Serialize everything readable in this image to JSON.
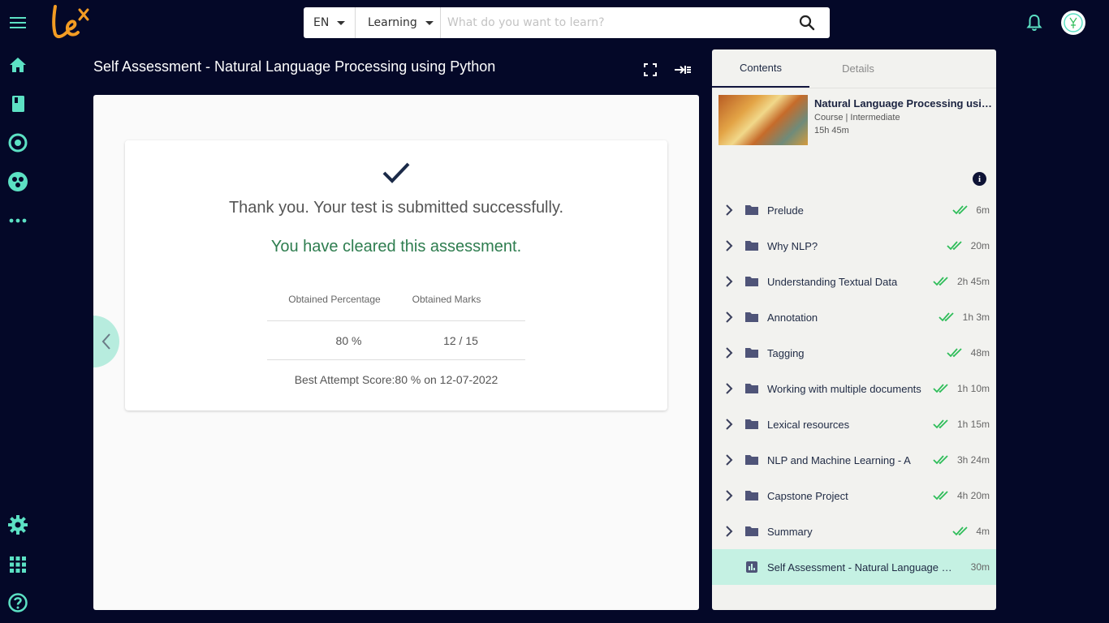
{
  "left_nav": {
    "items": [
      {
        "name": "menu-icon"
      },
      {
        "name": "home-icon"
      },
      {
        "name": "book-icon"
      },
      {
        "name": "target-icon"
      },
      {
        "name": "community-icon"
      },
      {
        "name": "more-icon"
      },
      {
        "name": "settings-icon"
      },
      {
        "name": "apps-icon"
      },
      {
        "name": "help-icon"
      }
    ]
  },
  "search": {
    "language": "EN",
    "category": "Learning",
    "placeholder": "What do you want to learn?"
  },
  "page_title": "Self Assessment - Natural Language Processing using Python",
  "result": {
    "thanks": "Thank you. Your test is submitted successfully.",
    "cleared": "You have cleared this assessment.",
    "col_percentage": "Obtained Percentage",
    "col_marks": "Obtained Marks",
    "percentage": "80 %",
    "marks": "12 / 15",
    "best_attempt": "Best Attempt Score:80 % on 12-07-2022"
  },
  "toc": {
    "tabs": [
      "Contents",
      "Details"
    ],
    "course": {
      "title": "Natural Language Processing using Python",
      "meta": "Course | Intermediate",
      "duration": "15h 45m"
    },
    "items": [
      {
        "label": "Prelude",
        "duration": "6m"
      },
      {
        "label": "Why NLP?",
        "duration": "20m"
      },
      {
        "label": "Understanding Textual Data",
        "duration": "2h 45m"
      },
      {
        "label": "Annotation",
        "duration": "1h 3m"
      },
      {
        "label": "Tagging",
        "duration": "48m"
      },
      {
        "label": "Working with multiple documents",
        "duration": "1h 10m"
      },
      {
        "label": "Lexical resources",
        "duration": "1h 15m"
      },
      {
        "label": "NLP and Machine Learning - A",
        "duration": "3h 24m"
      },
      {
        "label": "Capstone Project",
        "duration": "4h 20m"
      },
      {
        "label": "Summary",
        "duration": "4m"
      },
      {
        "label": "Self Assessment - Natural Language Processing using Python",
        "duration": "30m"
      }
    ]
  },
  "colors": {
    "background": "#040828",
    "accent": "#5ce1c4",
    "logo": "#f39c23",
    "success_text": "#2e7d4f",
    "check_green": "#2ebd59",
    "selected_row": "#c5f1e3"
  }
}
